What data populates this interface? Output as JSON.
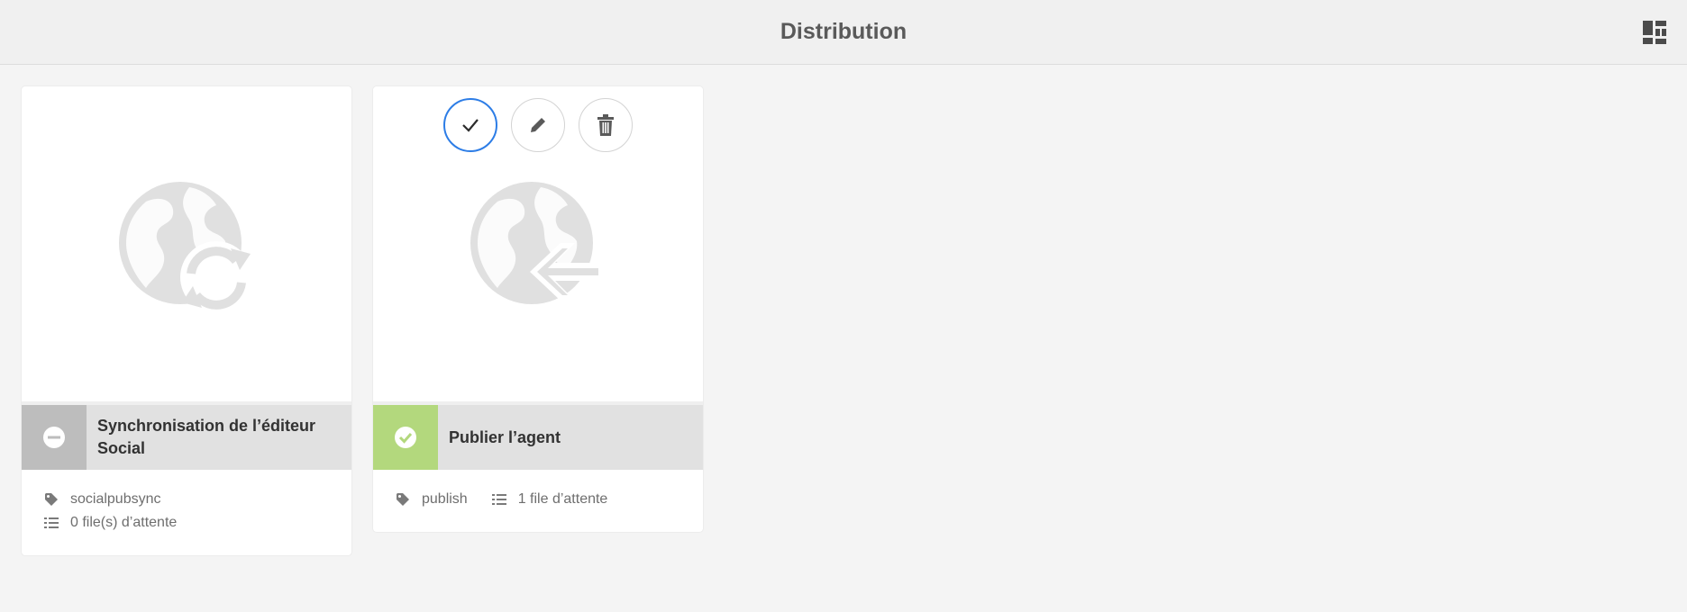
{
  "header": {
    "title": "Distribution",
    "view_switch_icon": "card-view-icon"
  },
  "cards": [
    {
      "title": "Synchronisation de l’éditeur Social",
      "status": "inactive",
      "status_color": "#bdbdbd",
      "thumbnail_icon": "globe-sync-icon",
      "tag": "socialpubsync",
      "queue": "0 file(s) d’attente"
    },
    {
      "title": "Publier l’agent",
      "status": "active",
      "status_color": "#b3d87d",
      "thumbnail_icon": "globe-arrow-left-icon",
      "tag": "publish",
      "queue": "1 file d’attente",
      "quick_actions": [
        "select",
        "edit",
        "delete"
      ],
      "selected_action_color": "#2d7de6"
    }
  ]
}
